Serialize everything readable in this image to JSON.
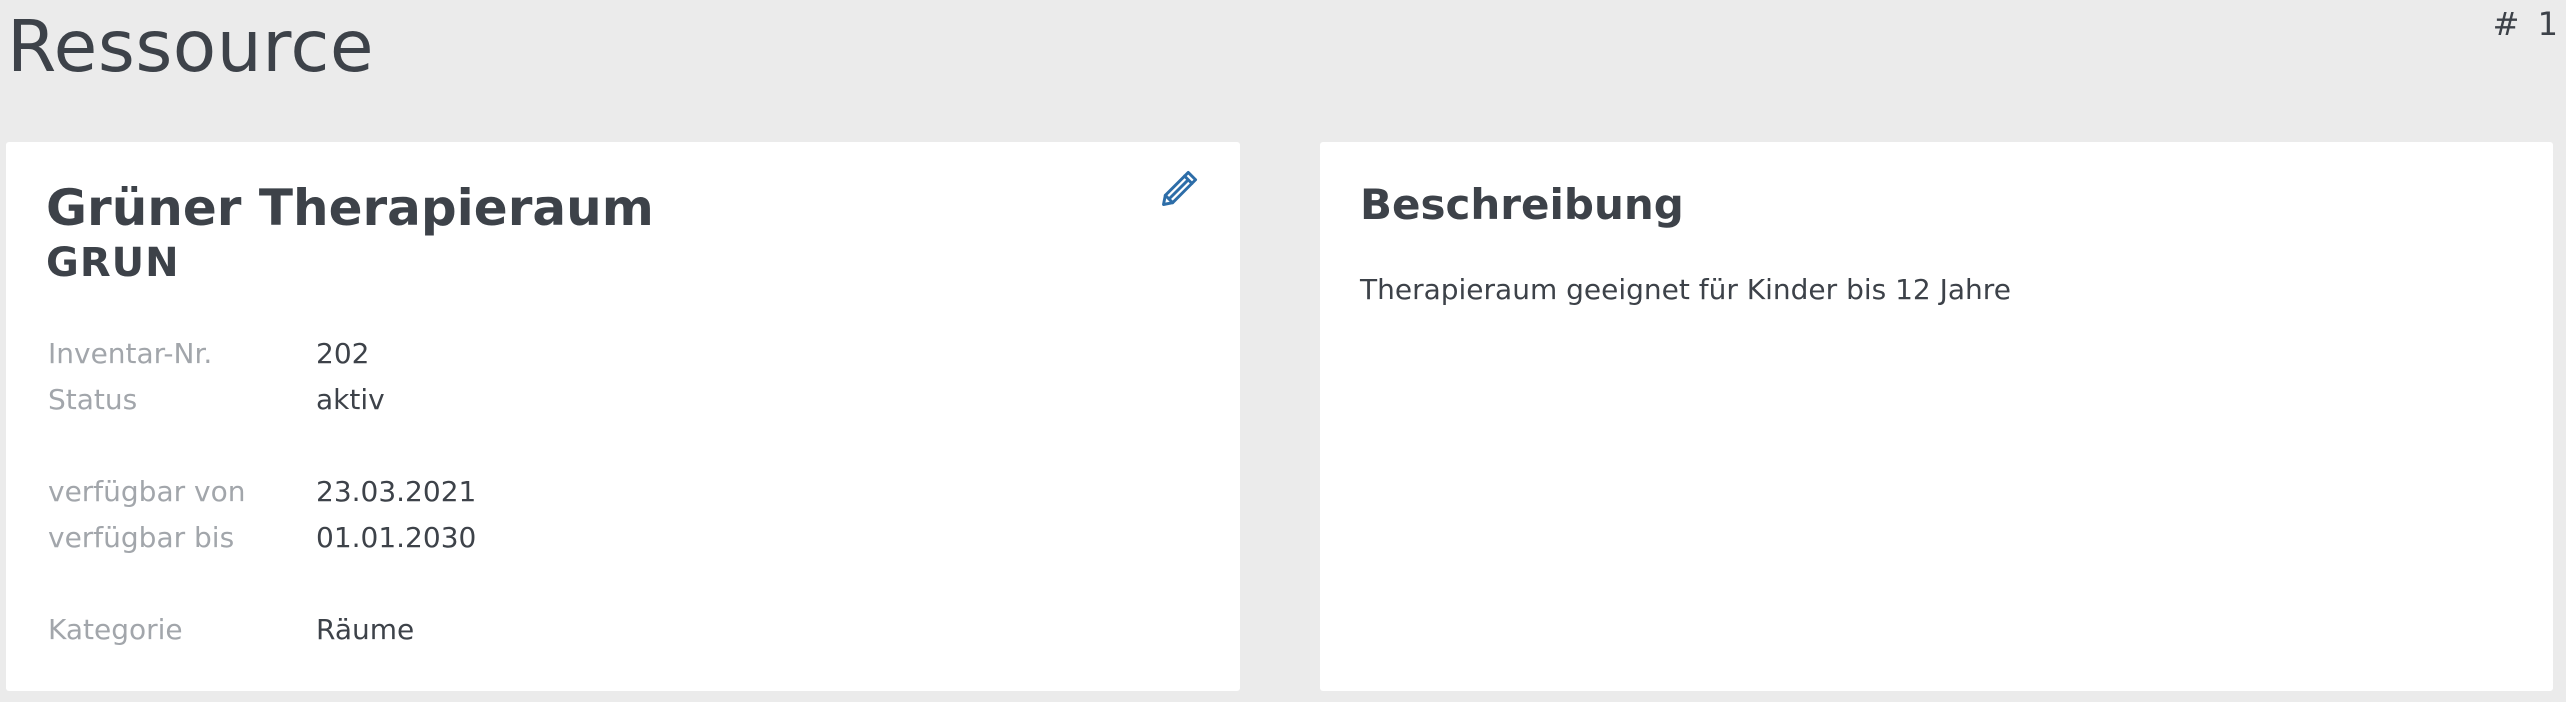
{
  "header": {
    "title": "Ressource",
    "record_id": "# 1"
  },
  "resource_card": {
    "name": "Grüner Therapieraum",
    "code": "GRUN",
    "edit_icon": "pencil-icon",
    "fields": [
      {
        "label": "Inventar-Nr.",
        "value": "202"
      },
      {
        "label": "Status",
        "value": "aktiv"
      },
      {
        "label": "verfügbar von",
        "value": "23.03.2021"
      },
      {
        "label": "verfügbar bis",
        "value": "01.01.2030"
      },
      {
        "label": "Kategorie",
        "value": "Räume"
      }
    ]
  },
  "description_card": {
    "title": "Beschreibung",
    "text": "Therapieraum geeignet für Kinder bis 12 Jahre"
  },
  "colors": {
    "background": "#ebebeb",
    "card": "#ffffff",
    "text": "#3d4249",
    "label": "#a2a6ab",
    "accent": "#2d6da8"
  }
}
